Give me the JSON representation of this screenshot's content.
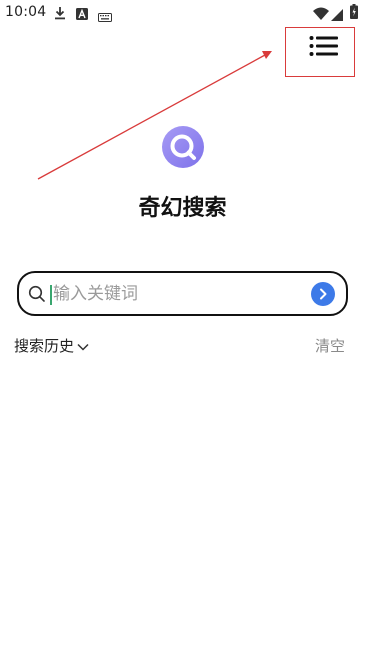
{
  "status_bar": {
    "time": "10:04",
    "icons": [
      "download-icon",
      "a-badge-icon",
      "keyboard-icon",
      "wifi-icon",
      "signal-icon",
      "battery-icon"
    ]
  },
  "header": {
    "menu_icon": "list-menu-icon"
  },
  "app": {
    "title": "奇幻搜索",
    "logo_icon": "search-logo-icon"
  },
  "search": {
    "placeholder": "输入关键词",
    "value": "",
    "go_icon": "arrow-right-icon"
  },
  "history": {
    "label": "搜索历史",
    "clear_label": "清空"
  },
  "colors": {
    "accent_blue": "#3d7ae8",
    "logo_purple": "#8c7ff0",
    "annotation_red": "#d93b3b",
    "caret_green": "#3aa66f"
  }
}
